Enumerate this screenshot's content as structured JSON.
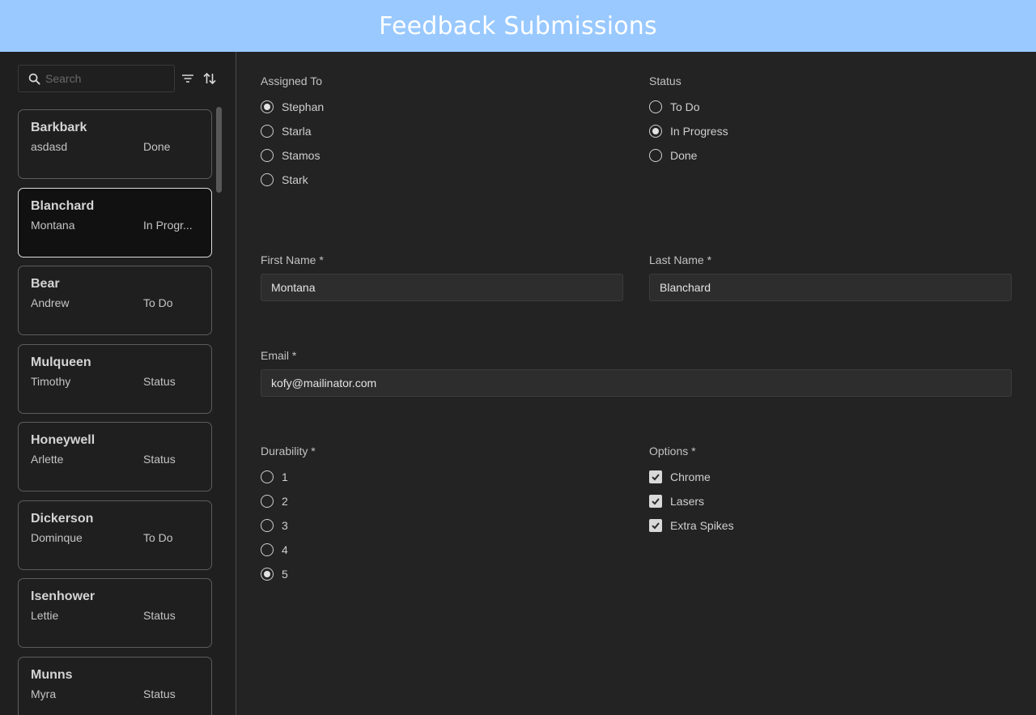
{
  "header": {
    "title": "Feedback Submissions"
  },
  "sidebar": {
    "search_placeholder": "Search",
    "items": [
      {
        "last": "Barkbark",
        "first": "asdasd",
        "status": "Done",
        "selected": false
      },
      {
        "last": "Blanchard",
        "first": "Montana",
        "status": "In Progr...",
        "selected": true
      },
      {
        "last": "Bear",
        "first": "Andrew",
        "status": "To Do",
        "selected": false
      },
      {
        "last": "Mulqueen",
        "first": "Timothy",
        "status": "Status",
        "selected": false
      },
      {
        "last": "Honeywell",
        "first": "Arlette",
        "status": "Status",
        "selected": false
      },
      {
        "last": "Dickerson",
        "first": "Dominque",
        "status": "To Do",
        "selected": false
      },
      {
        "last": "Isenhower",
        "first": "Lettie",
        "status": "Status",
        "selected": false
      },
      {
        "last": "Munns",
        "first": "Myra",
        "status": "Status",
        "selected": false
      }
    ]
  },
  "form": {
    "assigned_to": {
      "label": "Assigned To",
      "options": [
        "Stephan",
        "Starla",
        "Stamos",
        "Stark"
      ],
      "selected": "Stephan"
    },
    "status": {
      "label": "Status",
      "options": [
        "To Do",
        "In Progress",
        "Done"
      ],
      "selected": "In Progress"
    },
    "first_name": {
      "label": "First Name",
      "value": "Montana"
    },
    "last_name": {
      "label": "Last Name",
      "value": "Blanchard"
    },
    "email": {
      "label": "Email",
      "value": "kofy@mailinator.com"
    },
    "durability": {
      "label": "Durability",
      "options": [
        "1",
        "2",
        "3",
        "4",
        "5"
      ],
      "selected": "5"
    },
    "options": {
      "label": "Options",
      "items": [
        {
          "label": "Chrome",
          "checked": true
        },
        {
          "label": "Lasers",
          "checked": true
        },
        {
          "label": "Extra Spikes",
          "checked": true
        }
      ]
    },
    "required_marker": "*"
  }
}
